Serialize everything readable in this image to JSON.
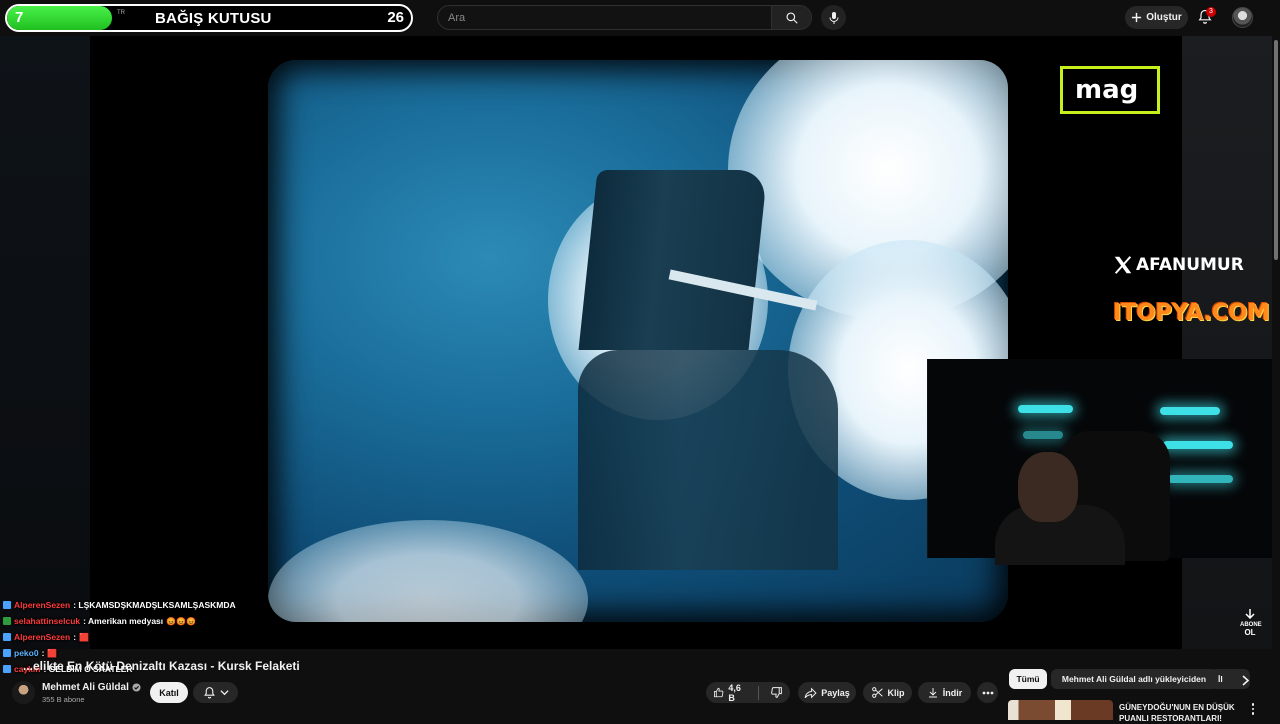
{
  "donation": {
    "left_value": "7",
    "title": "BAĞIŞ KUTUSU",
    "right_value": "26",
    "tr_mark": "TR",
    "progress": 0.26
  },
  "header": {
    "search_placeholder": "Ara",
    "create_label": "Oluştur",
    "notification_count": "3"
  },
  "overlay": {
    "mag_logo": "mag",
    "x_handle": "AFANUMUR",
    "sponsor": "ITOPYA.COM",
    "subscribe_watermark": [
      "ABONE",
      "OL"
    ]
  },
  "chat": [
    {
      "user": "AlperenSezen",
      "message": ": LŞKAMSDŞKMADŞLKSAMLŞASKMDA",
      "emoji": ""
    },
    {
      "user": "selahattinselcuk",
      "message": ": Amerikan medyası",
      "emoji": "😡😡😡"
    },
    {
      "user": "AlperenSezen",
      "message": ":",
      "emoji": "🟥"
    },
    {
      "user": "peko0",
      "message": ":",
      "emoji": "🟥"
    },
    {
      "user": "caykin",
      "message": ": GELDİM O SAATLER",
      "emoji": ""
    }
  ],
  "video": {
    "title": "...elikte En Kötü Denizaltı Kazası - Kursk Felaketi",
    "channel_name": "Mehmet Ali Güldal",
    "subscribers": "355 B abone",
    "join_label": "Katıl",
    "likes": "4,6 B",
    "share_label": "Paylaş",
    "clip_label": "Klip",
    "download_label": "İndir"
  },
  "sidebar": {
    "chips": [
      "Tümü",
      "Mehmet Ali Güldal adlı yükleyiciden",
      "İl"
    ],
    "recommendation_title": "GÜNEYDOĞU'NUN EN DÜŞÜK PUANLI RESTORANTLARI!"
  }
}
